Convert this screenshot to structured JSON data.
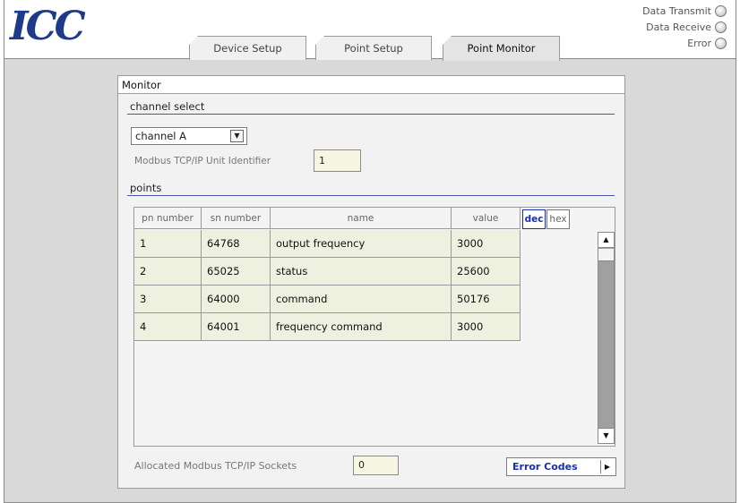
{
  "header": {
    "logo_text": "ICC",
    "tabs": [
      {
        "label": "Device Setup"
      },
      {
        "label": "Point Setup"
      },
      {
        "label": "Point Monitor"
      }
    ],
    "indicators": [
      {
        "label": "Data Transmit"
      },
      {
        "label": "Data Receive"
      },
      {
        "label": "Error"
      }
    ]
  },
  "monitor": {
    "title": "Monitor",
    "channel_section": "channel select",
    "channel_value": "channel A",
    "unit_id_label": "Modbus TCP/IP Unit Identifier",
    "unit_id_value": "1",
    "points_section": "points",
    "columns": [
      "pn number",
      "sn number",
      "name",
      "value"
    ],
    "format_buttons": [
      "dec",
      "hex"
    ],
    "rows": [
      {
        "pn": "1",
        "sn": "64768",
        "name": "output frequency",
        "value": "3000"
      },
      {
        "pn": "2",
        "sn": "65025",
        "name": "status",
        "value": "25600"
      },
      {
        "pn": "3",
        "sn": "64000",
        "name": "command",
        "value": "50176"
      },
      {
        "pn": "4",
        "sn": "64001",
        "name": "frequency command",
        "value": "3000"
      }
    ],
    "sockets_label": "Allocated Modbus TCP/IP Sockets",
    "sockets_value": "0",
    "error_codes_label": "Error Codes"
  }
}
